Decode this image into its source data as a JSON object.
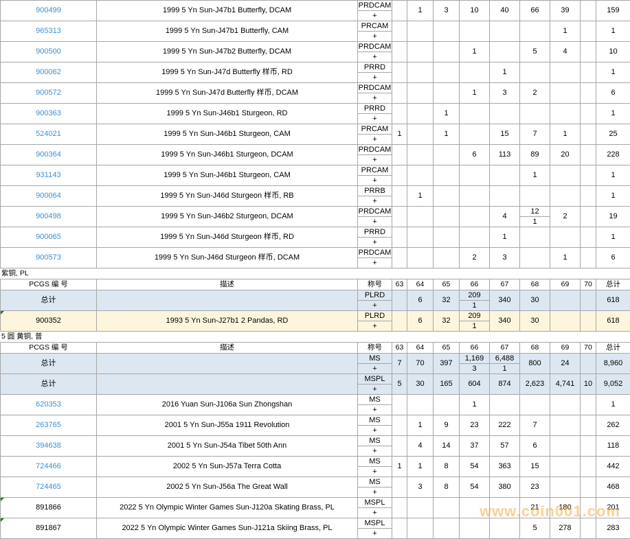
{
  "table1_rows": [
    {
      "id": "900499",
      "link": true,
      "desc": "1999 5 Yn Sun-J47b1 Butterfly, DCAM",
      "grade": "PRDCAM",
      "plus": "+",
      "c63": "",
      "c64": "1",
      "c65": "3",
      "c66": "10",
      "c67": "40",
      "c68": "66",
      "c69": "39",
      "c70": "",
      "total": "159"
    },
    {
      "id": "965313",
      "link": true,
      "desc": "1999 5 Yn Sun-J47b1 Butterfly, CAM",
      "grade": "PRCAM",
      "plus": "+",
      "c63": "",
      "c64": "",
      "c65": "",
      "c66": "",
      "c67": "",
      "c68": "",
      "c69": "1",
      "c70": "",
      "total": "1"
    },
    {
      "id": "900500",
      "link": true,
      "desc": "1999 5 Yn Sun-J47b2 Butterfly, DCAM",
      "grade": "PRDCAM",
      "plus": "+",
      "c63": "",
      "c64": "",
      "c65": "",
      "c66": "1",
      "c67": "",
      "c68": "5",
      "c69": "4",
      "c70": "",
      "total": "10"
    },
    {
      "id": "900062",
      "link": true,
      "desc": "1999 5 Yn Sun-J47d Butterfly 样币, RD",
      "grade": "PRRD",
      "plus": "+",
      "c63": "",
      "c64": "",
      "c65": "",
      "c66": "",
      "c67": "1",
      "c68": "",
      "c69": "",
      "c70": "",
      "total": "1"
    },
    {
      "id": "900572",
      "link": true,
      "desc": "1999 5 Yn Sun-J47d Butterfly 样币, DCAM",
      "grade": "PRDCAM",
      "plus": "+",
      "c63": "",
      "c64": "",
      "c65": "",
      "c66": "1",
      "c67": "3",
      "c68": "2",
      "c69": "",
      "c70": "",
      "total": "6"
    },
    {
      "id": "900363",
      "link": true,
      "desc": "1999 5 Yn Sun-J46b1 Sturgeon, RD",
      "grade": "PRRD",
      "plus": "+",
      "c63": "",
      "c64": "",
      "c65": "1",
      "c66": "",
      "c67": "",
      "c68": "",
      "c69": "",
      "c70": "",
      "total": "1"
    },
    {
      "id": "524021",
      "link": true,
      "desc": "1999 5 Yn Sun-J46b1 Sturgeon, CAM",
      "grade": "PRCAM",
      "plus": "+",
      "c63": "1",
      "c64": "",
      "c65": "1",
      "c66": "",
      "c67": "15",
      "c68": "7",
      "c69": "1",
      "c70": "",
      "total": "25"
    },
    {
      "id": "900364",
      "link": true,
      "desc": "1999 5 Yn Sun-J46b1 Sturgeon, DCAM",
      "grade": "PRDCAM",
      "plus": "+",
      "c63": "",
      "c64": "",
      "c65": "",
      "c66": "6",
      "c67": "113",
      "c68": "89",
      "c69": "20",
      "c70": "",
      "total": "228"
    },
    {
      "id": "931143",
      "link": true,
      "desc": "1999 5 Yn Sun-J46b1 Sturgeon, CAM",
      "grade": "PRCAM",
      "plus": "+",
      "c63": "",
      "c64": "",
      "c65": "",
      "c66": "",
      "c67": "",
      "c68": "1",
      "c69": "",
      "c70": "",
      "total": "1"
    },
    {
      "id": "900064",
      "link": true,
      "desc": "1999 5 Yn Sun-J46d Sturgeon 样币, RB",
      "grade": "PRRB",
      "plus": "+",
      "c63": "",
      "c64": "1",
      "c65": "",
      "c66": "",
      "c67": "",
      "c68": "",
      "c69": "",
      "c70": "",
      "total": "1"
    },
    {
      "id": "900498",
      "link": true,
      "desc": "1999 5 Yn Sun-J46b2 Sturgeon, DCAM",
      "grade": "PRDCAM",
      "plus": "+",
      "c63": "",
      "c64": "",
      "c65": "",
      "c66": "",
      "c67": "4",
      "c68": "12",
      "c68p": "1",
      "c69": "2",
      "c70": "",
      "total": "19"
    },
    {
      "id": "900065",
      "link": true,
      "desc": "1999 5 Yn Sun-J46d Sturgeon 样币, RD",
      "grade": "PRRD",
      "plus": "+",
      "c63": "",
      "c64": "",
      "c65": "",
      "c66": "",
      "c67": "1",
      "c68": "",
      "c69": "",
      "c70": "",
      "total": "1"
    },
    {
      "id": "900573",
      "link": true,
      "desc": "1999 5 Yn Sun-J46d Sturgeon 样币, DCAM",
      "grade": "PRDCAM",
      "plus": "+",
      "c63": "",
      "c64": "",
      "c65": "",
      "c66": "2",
      "c67": "3",
      "c68": "",
      "c69": "1",
      "c70": "",
      "total": "6"
    }
  ],
  "section2": {
    "title": "紫铜, PL",
    "header": {
      "id": "PCGS 编 号",
      "desc": "描述",
      "grade": "称号",
      "c63": "63",
      "c64": "64",
      "c65": "65",
      "c66": "66",
      "c67": "67",
      "c68": "68",
      "c69": "69",
      "c70": "70",
      "total": "总计"
    },
    "rows": [
      {
        "cls": "total",
        "id": "总计",
        "desc": "",
        "grade": "PLRD",
        "plus": "+",
        "c63": "",
        "c64": "6",
        "c65": "32",
        "c66": "209",
        "c66p": "1",
        "c67": "340",
        "c68": "30",
        "c69": "",
        "c70": "",
        "total": "618"
      },
      {
        "cls": "hl",
        "mark": true,
        "id": "900352",
        "desc": "1993 5 Yn Sun-J27b1 2 Pandas, RD",
        "grade": "PLRD",
        "plus": "+",
        "c63": "",
        "c64": "6",
        "c65": "32",
        "c66": "209",
        "c66p": "1",
        "c67": "340",
        "c68": "30",
        "c69": "",
        "c70": "",
        "total": "618"
      }
    ]
  },
  "section3": {
    "title": "5 圆 黄铜, 普",
    "header": {
      "id": "PCGS 编 号",
      "desc": "描述",
      "grade": "称号",
      "c63": "63",
      "c64": "64",
      "c65": "65",
      "c66": "66",
      "c67": "67",
      "c68": "68",
      "c69": "69",
      "c70": "70",
      "total": "总计"
    },
    "rows": [
      {
        "cls": "total",
        "id": "总计",
        "desc": "",
        "grade": "MS",
        "plus": "+",
        "c63": "7",
        "c64": "70",
        "c65": "397",
        "c66": "1,169",
        "c66p": "3",
        "c67": "6,488",
        "c67p": "1",
        "c68": "800",
        "c69": "24",
        "c70": "",
        "total": "8,960"
      },
      {
        "cls": "total",
        "id": "总计",
        "desc": "",
        "grade": "MSPL",
        "plus": "+",
        "c63": "5",
        "c64": "30",
        "c65": "165",
        "c66": "604",
        "c67": "874",
        "c68": "2,623",
        "c69": "4,741",
        "c70": "10",
        "total": "9,052"
      },
      {
        "link": true,
        "id": "620353",
        "desc": "2016 Yuan Sun-J106a Sun Zhongshan",
        "grade": "MS",
        "plus": "+",
        "c63": "",
        "c64": "",
        "c65": "",
        "c66": "1",
        "c67": "",
        "c68": "",
        "c69": "",
        "c70": "",
        "total": "1"
      },
      {
        "link": true,
        "id": "263765",
        "desc": "2001 5 Yn Sun-J55a 1911 Revolution",
        "grade": "MS",
        "plus": "+",
        "c63": "",
        "c64": "1",
        "c65": "9",
        "c66": "23",
        "c67": "222",
        "c68": "7",
        "c69": "",
        "c70": "",
        "total": "262"
      },
      {
        "link": true,
        "id": "394638",
        "desc": "2001 5 Yn Sun-J54a Tibet 50th Ann",
        "grade": "MS",
        "plus": "+",
        "c63": "",
        "c64": "4",
        "c65": "14",
        "c66": "37",
        "c67": "57",
        "c68": "6",
        "c69": "",
        "c70": "",
        "total": "118"
      },
      {
        "link": true,
        "id": "724466",
        "desc": "2002 5 Yn Sun-J57a Terra Cotta",
        "grade": "MS",
        "plus": "+",
        "c63": "1",
        "c64": "1",
        "c65": "8",
        "c66": "54",
        "c67": "363",
        "c68": "15",
        "c69": "",
        "c70": "",
        "total": "442"
      },
      {
        "link": true,
        "id": "724465",
        "desc": "2002 5 Yn Sun-J56a The Great Wall",
        "grade": "MS",
        "plus": "+",
        "c63": "",
        "c64": "3",
        "c65": "8",
        "c66": "54",
        "c67": "380",
        "c68": "23",
        "c69": "",
        "c70": "",
        "total": "468"
      },
      {
        "mark": true,
        "id": "891866",
        "desc": "2022 5 Yn Olympic Winter Games Sun-J120a Skating Brass, PL",
        "grade": "MSPL",
        "plus": "+",
        "c63": "",
        "c64": "",
        "c65": "",
        "c66": "",
        "c67": "",
        "c68": "21",
        "c69": "180",
        "c70": "",
        "total": "201"
      },
      {
        "mark": true,
        "id": "891867",
        "desc": "2022 5 Yn Olympic Winter Games Sun-J121a Skiing Brass, PL",
        "grade": "MSPL",
        "plus": "+",
        "c63": "",
        "c64": "",
        "c65": "",
        "c66": "",
        "c67": "",
        "c68": "5",
        "c69": "278",
        "c70": "",
        "total": "283"
      }
    ]
  },
  "watermark": "www.coin001.com"
}
